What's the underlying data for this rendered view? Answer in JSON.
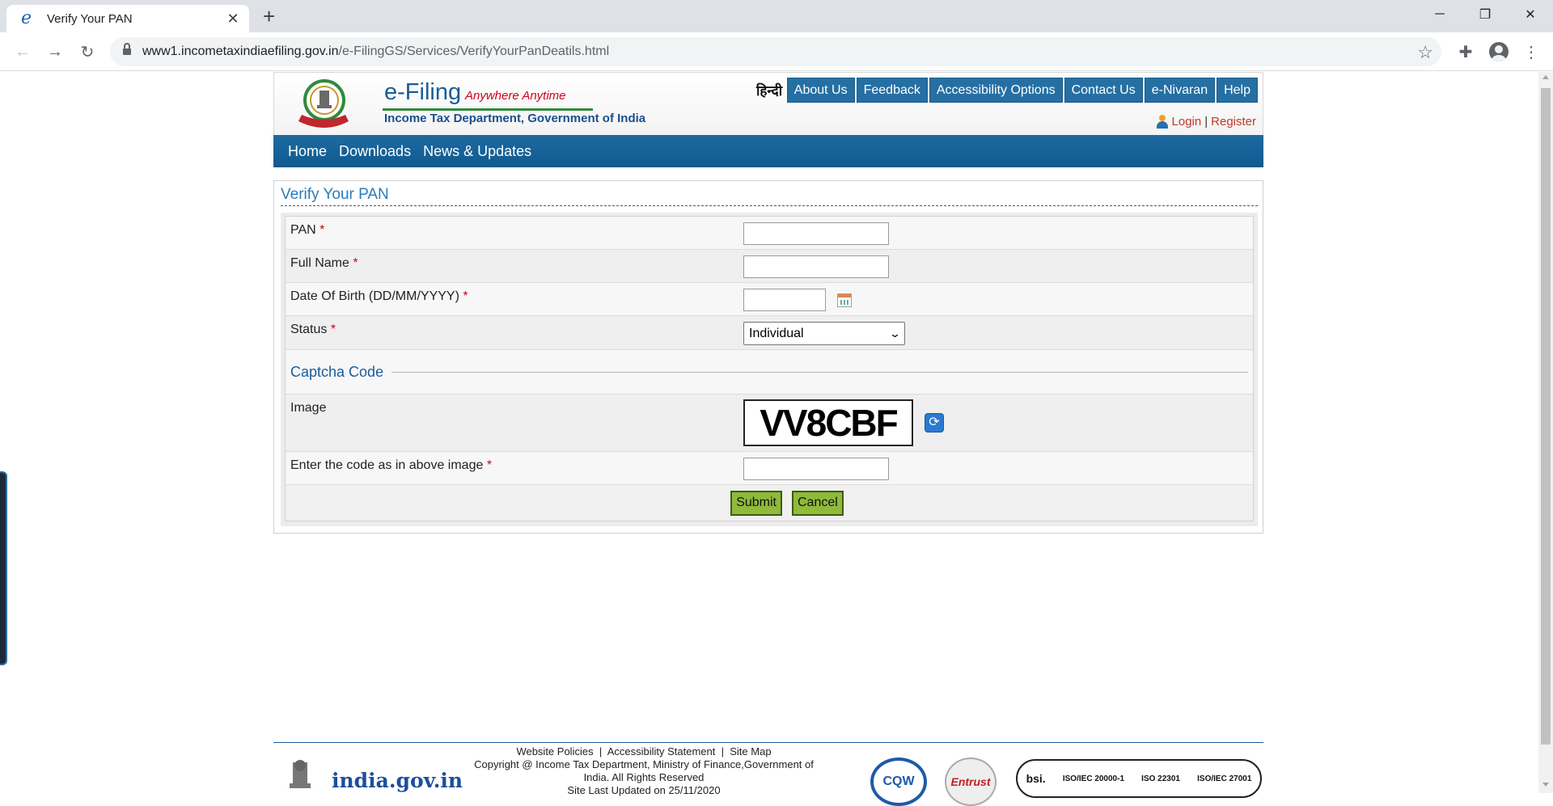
{
  "browser": {
    "tab_title": "Verify Your PAN",
    "new_tab": "+",
    "url_host": "www1.incometaxindiaefiling.gov.in",
    "url_path": "/e-FilingGS/Services/VerifyYourPanDeatils.html"
  },
  "header": {
    "logo_main": "e-Filing",
    "logo_tagline": "Anywhere Anytime",
    "logo_sub": "Income Tax Department, Government of India",
    "hindi_link": "हिन्दी",
    "top_nav": [
      "About Us",
      "Feedback",
      "Accessibility Options",
      "Contact Us",
      "e-Nivaran",
      "Help"
    ],
    "login": "Login",
    "separator": "|",
    "register": "Register"
  },
  "main_nav": [
    "Home",
    "Downloads",
    "News & Updates"
  ],
  "panel": {
    "title": "Verify Your PAN",
    "fields": {
      "pan": {
        "label": "PAN",
        "value": ""
      },
      "full_name": {
        "label": "Full Name",
        "value": ""
      },
      "dob": {
        "label": "Date Of Birth (DD/MM/YYYY)",
        "value": ""
      },
      "status": {
        "label": "Status",
        "selected": "Individual"
      }
    },
    "required_marker": "*",
    "captcha": {
      "heading": "Captcha Code",
      "image_label": "Image",
      "code_text": "VV8CBF",
      "entry_label": "Enter the code as in above image",
      "entry_value": ""
    },
    "buttons": {
      "submit": "Submit",
      "cancel": "Cancel"
    }
  },
  "footer": {
    "links": [
      "Website Policies",
      "Accessibility Statement",
      "Site Map"
    ],
    "link_separator": "|",
    "copyright": "Copyright @ Income Tax Department, Ministry of Finance,Government of India. All Rights Reserved",
    "updated": "Site Last Updated on 25/11/2020",
    "india_gov": "india.gov.in",
    "cert_entrust": "Entrust",
    "cert_cqw": "CQW",
    "cert_bsi": "bsi.",
    "cert_iso": [
      "ISO/IEC 20000-1",
      "ISO 22301",
      "ISO/IEC 27001"
    ]
  },
  "colors": {
    "nav_blue": "#256fa3",
    "button_green": "#8fba3a",
    "required_red": "#d0021b",
    "title_blue": "#2a7cb8"
  }
}
